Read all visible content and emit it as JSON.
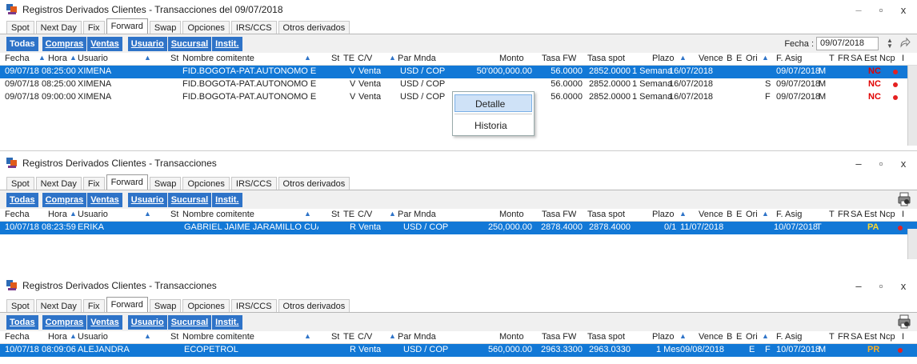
{
  "windows": [
    {
      "title": "Registros Derivados Clientes - Transacciones del 09/07/2018",
      "tabs": [
        "Spot",
        "Next Day",
        "Fix",
        "Forward",
        "Swap",
        "Opciones",
        "IRS/CCS",
        "Otros derivados"
      ],
      "active_tab": "Forward",
      "filters": [
        "Todas",
        "Compras",
        "Ventas",
        "Usuario",
        "Sucursal",
        "Instit."
      ],
      "fecha_label": "Fecha :",
      "fecha_value": "09/07/2018",
      "columns": [
        "Fecha",
        "Hora",
        "Usuario",
        "St",
        "Nombre comitente",
        "St",
        "TE",
        "C/V",
        "Par Mnda",
        "Monto",
        "Tasa FW",
        "Tasa spot",
        "Plazo",
        "Vence",
        "B",
        "E",
        "Ori",
        "F. Asig",
        "T",
        "FR",
        "SA",
        "Est",
        "Ncp",
        "I"
      ],
      "rows": [
        {
          "fecha": "09/07/18",
          "hora": "08:25:00",
          "usuario": "XIMENA",
          "nombre": "FID.BOGOTA-PAT.AUTONOMO E",
          "st": "V",
          "cv": "Venta",
          "par": "USD / COP",
          "monto": "50'000,000.00",
          "tasafw": "56.0000",
          "tasaspot": "2852.0000",
          "plazo": "1 Semana",
          "vence": "16/07/2018",
          "ori": "",
          "fasig": "09/07/2018",
          "t": "M",
          "est": "NC"
        },
        {
          "fecha": "09/07/18",
          "hora": "08:25:00",
          "usuario": "XIMENA",
          "nombre": "FID.BOGOTA-PAT.AUTONOMO E",
          "st": "V",
          "cv": "Venta",
          "par": "USD / COP",
          "monto": "",
          "tasafw": "56.0000",
          "tasaspot": "2852.0000",
          "plazo": "1 Semana",
          "vence": "16/07/2018",
          "ori": "S",
          "fasig": "09/07/2018",
          "t": "M",
          "est": "NC"
        },
        {
          "fecha": "09/07/18",
          "hora": "09:00:00",
          "usuario": "XIMENA",
          "nombre": "FID.BOGOTA-PAT.AUTONOMO E",
          "st": "V",
          "cv": "Venta",
          "par": "USD / COP",
          "monto": "",
          "tasafw": "56.0000",
          "tasaspot": "2852.0000",
          "plazo": "1 Semana",
          "vence": "16/07/2018",
          "ori": "F",
          "fasig": "09/07/2018",
          "t": "M",
          "est": "NC"
        }
      ],
      "context_menu": [
        "Detalle",
        "Historia"
      ]
    },
    {
      "title": "Registros Derivados Clientes - Transacciones",
      "tabs": [
        "Spot",
        "Next Day",
        "Fix",
        "Forward",
        "Swap",
        "Opciones",
        "IRS/CCS",
        "Otros derivados"
      ],
      "active_tab": "Forward",
      "filters": [
        "Todas",
        "Compras",
        "Ventas",
        "Usuario",
        "Sucursal",
        "Instit."
      ],
      "columns": [
        "Fecha",
        "Hora",
        "Usuario",
        "St",
        "Nombre comitente",
        "St",
        "TE",
        "C/V",
        "Par Mnda",
        "Monto",
        "Tasa FW",
        "Tasa spot",
        "Plazo",
        "Vence",
        "B",
        "E",
        "Ori",
        "F. Asig",
        "T",
        "FR",
        "SA",
        "Est",
        "Ncp",
        "I"
      ],
      "rows": [
        {
          "fecha": "10/07/18",
          "hora": "08:23:59",
          "usuario": "ERIKA",
          "nombre": "GABRIEL JAIME JARAMILLO CUA",
          "st": "R",
          "cv": "Venta",
          "par": "USD / COP",
          "monto": "250,000.00",
          "tasafw": "2878.4000",
          "tasaspot": "2878.4000",
          "plazo": "0/1",
          "vence": "11/07/2018",
          "b": "",
          "e": "",
          "fasig": "10/07/2018",
          "t": "T",
          "est": "PA"
        }
      ]
    },
    {
      "title": "Registros Derivados Clientes - Transacciones",
      "tabs": [
        "Spot",
        "Next Day",
        "Fix",
        "Forward",
        "Swap",
        "Opciones",
        "IRS/CCS",
        "Otros derivados"
      ],
      "active_tab": "Forward",
      "filters": [
        "Todas",
        "Compras",
        "Ventas",
        "Usuario",
        "Sucursal",
        "Instit."
      ],
      "columns": [
        "Fecha",
        "Hora",
        "Usuario",
        "St",
        "Nombre comitente",
        "St",
        "TE",
        "C/V",
        "Par Mnda",
        "Monto",
        "Tasa FW",
        "Tasa spot",
        "Plazo",
        "Vence",
        "B",
        "E",
        "Ori",
        "F. Asig",
        "T",
        "FR",
        "SA",
        "Est",
        "Ncp",
        "I"
      ],
      "rows": [
        {
          "fecha": "10/07/18",
          "hora": "08:09:06",
          "usuario": "ALEJANDRA",
          "nombre": "ECOPETROL",
          "st": "R",
          "cv": "Venta",
          "par": "USD / COP",
          "monto": "560,000.00",
          "tasafw": "2963.3300",
          "tasaspot": "2963.0330",
          "plazo": "1 Mes",
          "vence": "09/08/2018",
          "b": "",
          "e": "E",
          "ori": "F",
          "fasig": "10/07/2018",
          "t": "M",
          "est": "PR"
        }
      ]
    }
  ]
}
